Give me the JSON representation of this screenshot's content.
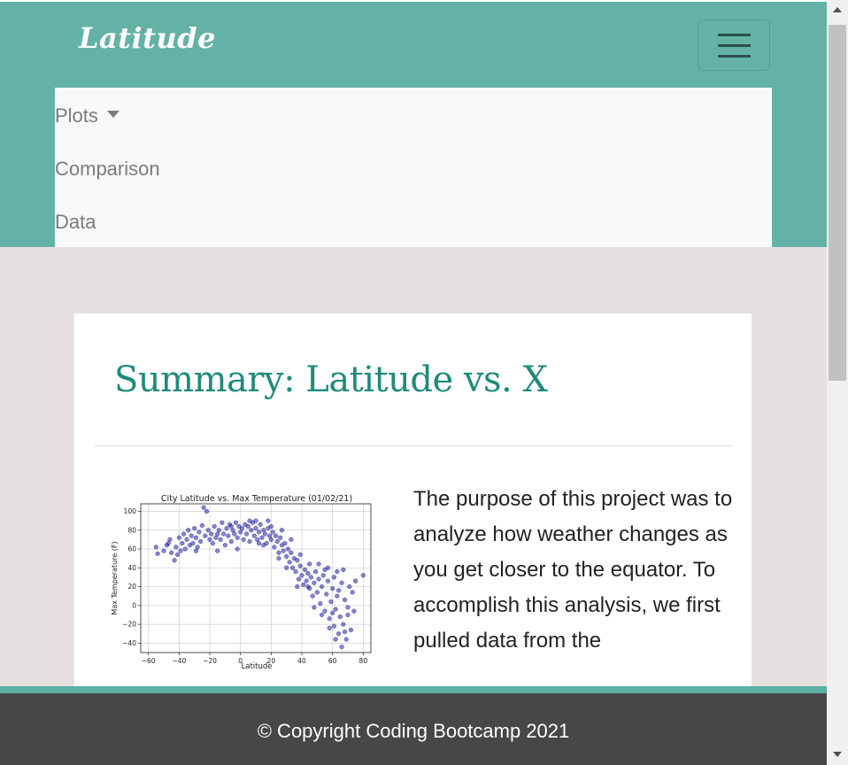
{
  "navbar": {
    "brand": "Latitude",
    "menu_items": [
      {
        "label": "Plots",
        "has_dropdown": true
      },
      {
        "label": "Comparison"
      },
      {
        "label": "Data"
      }
    ]
  },
  "main": {
    "title": "Summary: Latitude vs. X",
    "text": "The purpose of this project was to analyze how weather changes as you get closer to the equator. To accomplish this analysis, we first pulled data from the"
  },
  "footer": {
    "copyright": "© Copyright Coding Bootcamp 2021"
  },
  "colors": {
    "navbar_bg": "#64b2a6",
    "title": "#1f8b7a",
    "footer_bg": "#474747",
    "point": "#1f1fa8"
  },
  "chart_data": {
    "type": "scatter",
    "title": "City Latitude vs. Max Temperature (01/02/21)",
    "xlabel": "Latitude",
    "ylabel": "Max Temperature (F)",
    "xlim": [
      -65,
      85
    ],
    "ylim": [
      -50,
      108
    ],
    "xticks": [
      -60,
      -40,
      -20,
      0,
      20,
      40,
      60,
      80
    ],
    "yticks": [
      -40,
      -20,
      0,
      20,
      40,
      60,
      80,
      100
    ],
    "grid": true,
    "points": [
      [
        -55,
        62
      ],
      [
        -54,
        55
      ],
      [
        -50,
        58
      ],
      [
        -48,
        64
      ],
      [
        -46,
        70
      ],
      [
        -45,
        56
      ],
      [
        -43,
        48
      ],
      [
        -42,
        62
      ],
      [
        -40,
        72
      ],
      [
        -39,
        58
      ],
      [
        -38,
        66
      ],
      [
        -37,
        76
      ],
      [
        -36,
        60
      ],
      [
        -35,
        70
      ],
      [
        -34,
        80
      ],
      [
        -33,
        64
      ],
      [
        -32,
        74
      ],
      [
        -31,
        66
      ],
      [
        -30,
        82
      ],
      [
        -29,
        72
      ],
      [
        -28,
        62
      ],
      [
        -27,
        78
      ],
      [
        -26,
        68
      ],
      [
        -25,
        85
      ],
      [
        -24,
        104
      ],
      [
        -23,
        74
      ],
      [
        -22,
        100
      ],
      [
        -21,
        80
      ],
      [
        -20,
        70
      ],
      [
        -19,
        76
      ],
      [
        -18,
        66
      ],
      [
        -17,
        84
      ],
      [
        -16,
        72
      ],
      [
        -15,
        58
      ],
      [
        -14,
        80
      ],
      [
        -13,
        70
      ],
      [
        -12,
        88
      ],
      [
        -11,
        76
      ],
      [
        -10,
        64
      ],
      [
        -9,
        82
      ],
      [
        -8,
        74
      ],
      [
        -7,
        86
      ],
      [
        -6,
        68
      ],
      [
        -5,
        80
      ],
      [
        -4,
        76
      ],
      [
        -3,
        88
      ],
      [
        -2,
        72
      ],
      [
        -1,
        84
      ],
      [
        0,
        78
      ],
      [
        1,
        82
      ],
      [
        2,
        70
      ],
      [
        3,
        86
      ],
      [
        4,
        76
      ],
      [
        5,
        84
      ],
      [
        6,
        68
      ],
      [
        7,
        80
      ],
      [
        8,
        88
      ],
      [
        9,
        74
      ],
      [
        10,
        82
      ],
      [
        11,
        70
      ],
      [
        12,
        78
      ],
      [
        13,
        86
      ],
      [
        14,
        72
      ],
      [
        15,
        80
      ],
      [
        16,
        76
      ],
      [
        17,
        66
      ],
      [
        18,
        82
      ],
      [
        19,
        74
      ],
      [
        20,
        70
      ],
      [
        21,
        78
      ],
      [
        22,
        62
      ],
      [
        23,
        74
      ],
      [
        24,
        68
      ],
      [
        25,
        56
      ],
      [
        26,
        72
      ],
      [
        27,
        64
      ],
      [
        28,
        58
      ],
      [
        29,
        66
      ],
      [
        30,
        52
      ],
      [
        31,
        60
      ],
      [
        32,
        46
      ],
      [
        33,
        56
      ],
      [
        34,
        40
      ],
      [
        35,
        50
      ],
      [
        36,
        36
      ],
      [
        37,
        48
      ],
      [
        38,
        28
      ],
      [
        39,
        42
      ],
      [
        40,
        32
      ],
      [
        41,
        22
      ],
      [
        42,
        38
      ],
      [
        43,
        26
      ],
      [
        44,
        34
      ],
      [
        45,
        18
      ],
      [
        46,
        30
      ],
      [
        47,
        10
      ],
      [
        48,
        24
      ],
      [
        49,
        36
      ],
      [
        50,
        14
      ],
      [
        51,
        28
      ],
      [
        52,
        2
      ],
      [
        53,
        20
      ],
      [
        54,
        32
      ],
      [
        55,
        -6
      ],
      [
        56,
        12
      ],
      [
        57,
        26
      ],
      [
        58,
        -14
      ],
      [
        59,
        4
      ],
      [
        60,
        18
      ],
      [
        61,
        -22
      ],
      [
        62,
        -4
      ],
      [
        63,
        10
      ],
      [
        64,
        -30
      ],
      [
        65,
        -12
      ],
      [
        66,
        24
      ],
      [
        67,
        -20
      ],
      [
        68,
        6
      ],
      [
        69,
        -36
      ],
      [
        70,
        -10
      ],
      [
        71,
        20
      ],
      [
        72,
        -26
      ],
      [
        73,
        14
      ],
      [
        74,
        -6
      ],
      [
        75,
        26
      ],
      [
        80,
        32
      ],
      [
        -47,
        66
      ],
      [
        -41,
        54
      ],
      [
        -29,
        58
      ],
      [
        -15,
        76
      ],
      [
        -6,
        84
      ],
      [
        6,
        90
      ],
      [
        12,
        66
      ],
      [
        18,
        90
      ],
      [
        27,
        80
      ],
      [
        33,
        70
      ],
      [
        39,
        54
      ],
      [
        45,
        44
      ],
      [
        51,
        44
      ],
      [
        57,
        40
      ],
      [
        63,
        36
      ],
      [
        67,
        38
      ],
      [
        55,
        38
      ],
      [
        61,
        30
      ],
      [
        48,
        -2
      ],
      [
        53,
        -10
      ],
      [
        58,
        -24
      ],
      [
        62,
        -36
      ],
      [
        66,
        -44
      ],
      [
        68,
        -28
      ],
      [
        70,
        -2
      ],
      [
        60,
        -8
      ],
      [
        64,
        16
      ],
      [
        44,
        20
      ],
      [
        37,
        20
      ],
      [
        30,
        40
      ],
      [
        25,
        50
      ],
      [
        20,
        84
      ],
      [
        15,
        64
      ],
      [
        10,
        90
      ],
      [
        -2,
        60
      ]
    ]
  }
}
